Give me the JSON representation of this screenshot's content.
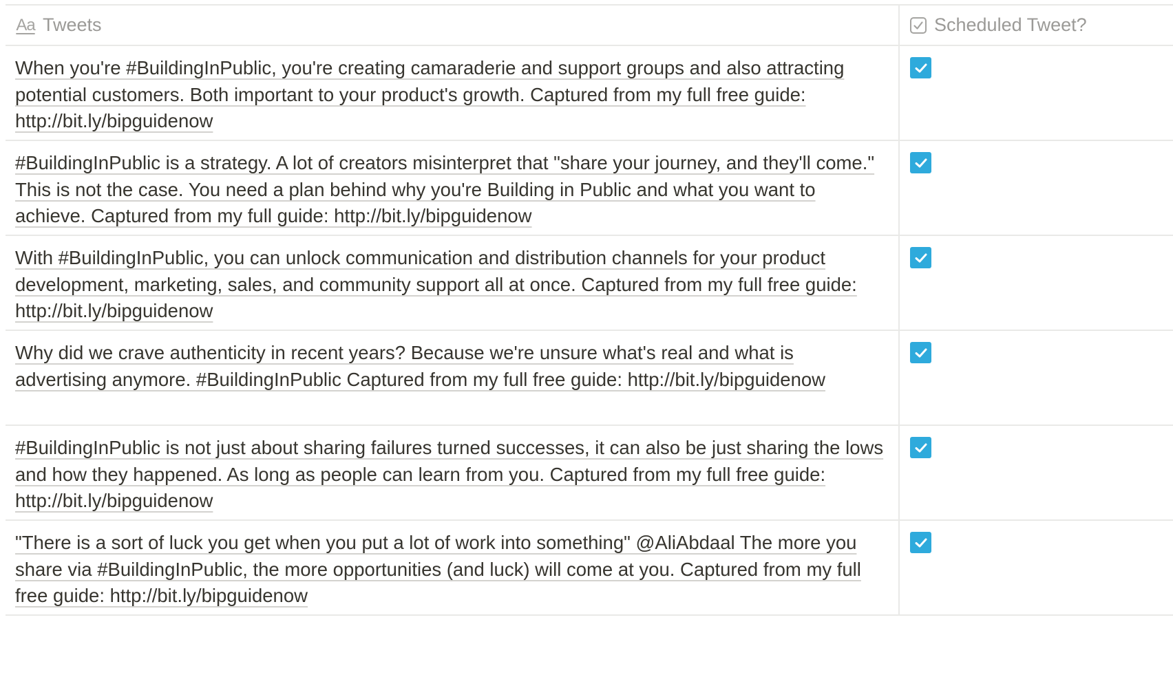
{
  "table": {
    "columns": [
      {
        "label": "Tweets",
        "icon": "text-property-icon"
      },
      {
        "label": "Scheduled Tweet?",
        "icon": "checkbox-property-icon"
      }
    ],
    "rows": [
      {
        "tweet": "When you're #BuildingInPublic, you're creating camaraderie and support groups and also attracting potential customers. Both important to your product's growth. Captured from my full free guide: http://bit.ly/bipguidenow",
        "scheduled": true
      },
      {
        "tweet": "#BuildingInPublic is a strategy. A lot of creators misinterpret that \"share your journey, and they'll come.\" This is not the case. You need a plan behind why you're Building in Public and what you want to achieve. Captured from my full guide: http://bit.ly/bipguidenow",
        "scheduled": true
      },
      {
        "tweet": "With #BuildingInPublic, you can unlock communication and distribution channels for your product development, marketing, sales, and community support all at once. Captured from my full free guide: http://bit.ly/bipguidenow",
        "scheduled": true
      },
      {
        "tweet": "Why did we crave authenticity in recent years? Because we're unsure what's real and what is advertising anymore. #BuildingInPublic Captured from my full free guide: http://bit.ly/bipguidenow",
        "scheduled": true
      },
      {
        "tweet": "#BuildingInPublic is not just about sharing failures turned successes, it can also be just sharing the lows and how they happened. As long as people can learn from you. Captured from my full free guide: http://bit.ly/bipguidenow",
        "scheduled": true
      },
      {
        "tweet": "\"There is a sort of luck you get when you put a lot of work into something\" @AliAbdaal The more you share via #BuildingInPublic, the more opportunities (and luck) will come at you. Captured from my full free guide: http://bit.ly/bipguidenow",
        "scheduled": true
      }
    ]
  },
  "colors": {
    "checkbox_checked": "#2eaadc",
    "border": "#e9e9e7",
    "header_text": "#9b9a97",
    "body_text": "#37352f"
  }
}
